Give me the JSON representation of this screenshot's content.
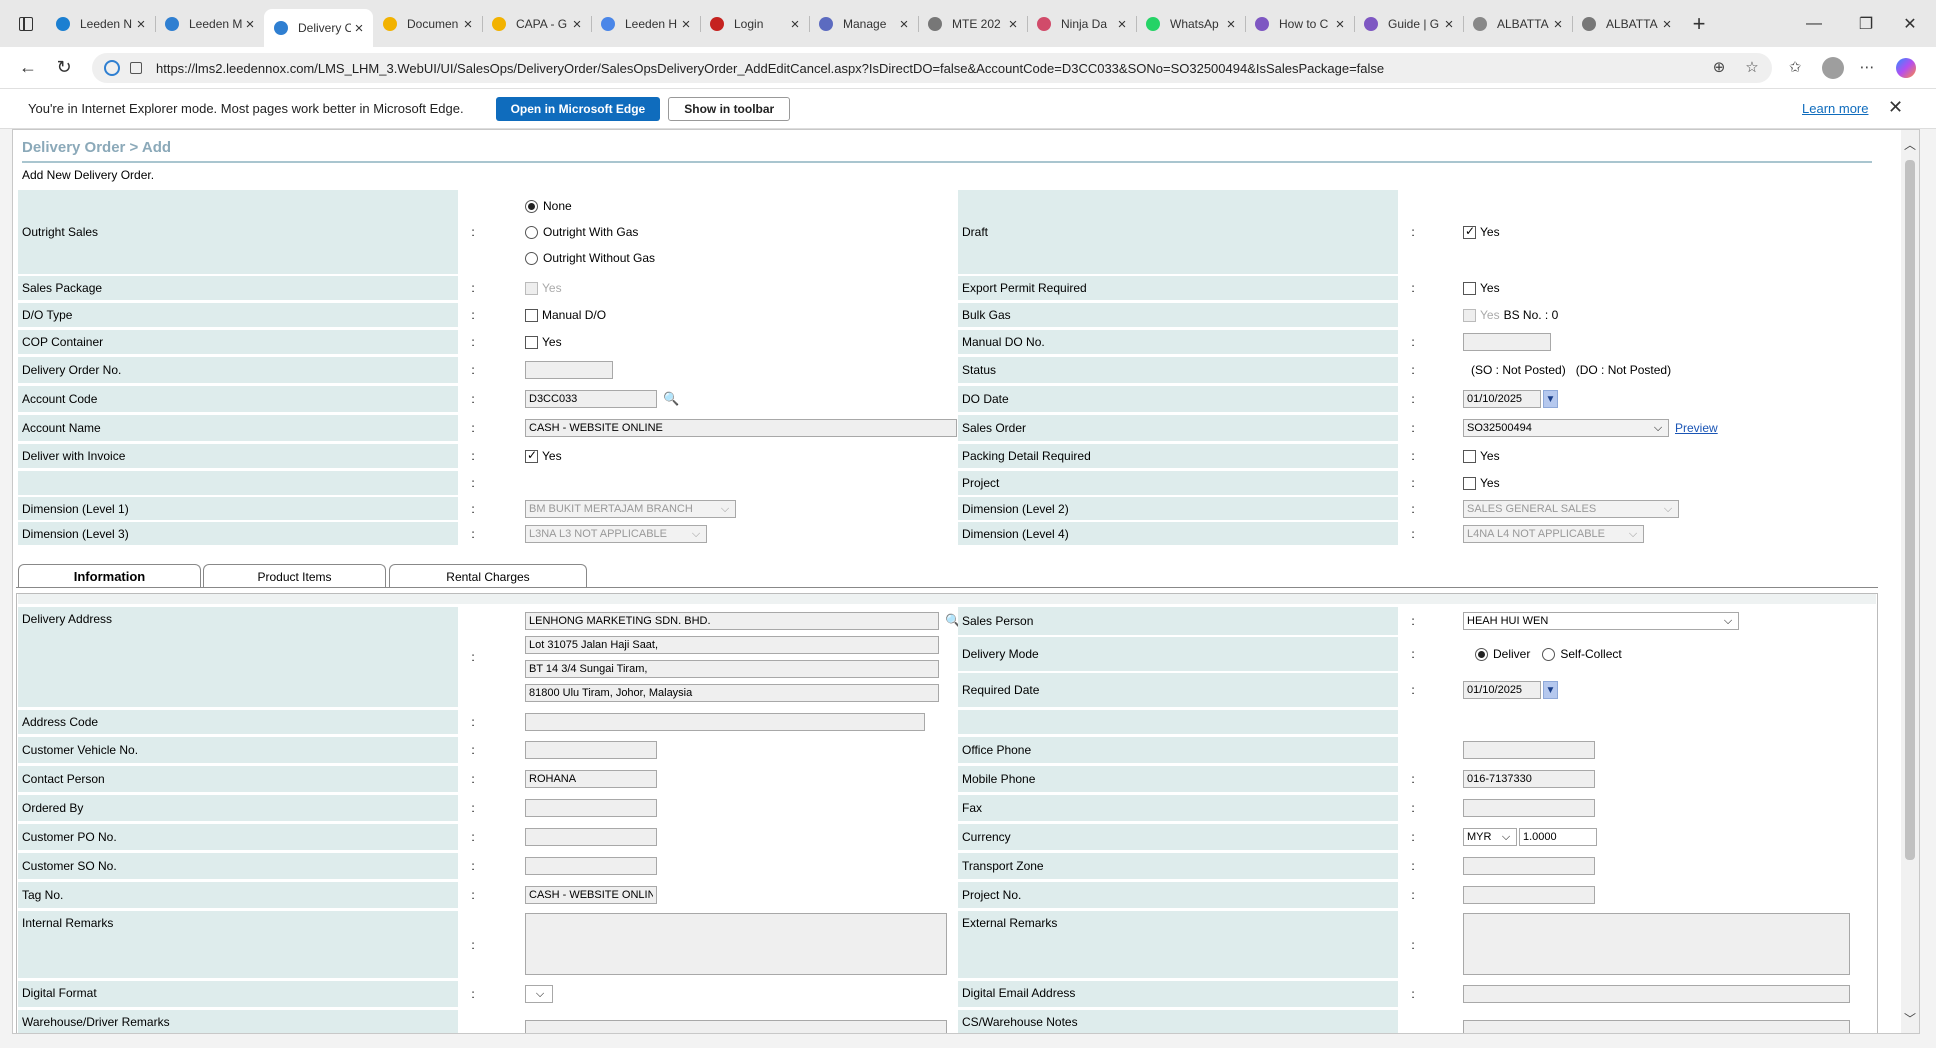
{
  "browser": {
    "tabs": [
      {
        "label": "Leeden N",
        "color": "#1b7fd1"
      },
      {
        "label": "Leeden M",
        "color": "#2f7fd1"
      },
      {
        "label": "Delivery O",
        "color": "#2f7fd1",
        "active": true
      },
      {
        "label": "Documen",
        "color": "#f2b200"
      },
      {
        "label": "CAPA - G",
        "color": "#f2b200"
      },
      {
        "label": "Leeden H",
        "color": "#4a86e8"
      },
      {
        "label": "Login",
        "color": "#c5221f"
      },
      {
        "label": "Manage",
        "color": "#5c6bc0"
      },
      {
        "label": "MTE 202",
        "color": "#777777"
      },
      {
        "label": "Ninja Da",
        "color": "#d14b6a"
      },
      {
        "label": "WhatsAp",
        "color": "#25d366"
      },
      {
        "label": "How to C",
        "color": "#7e57c2"
      },
      {
        "label": "Guide | G",
        "color": "#7e57c2"
      },
      {
        "label": "ALBATTA",
        "color": "#888888"
      },
      {
        "label": "ALBATTA",
        "color": "#777777"
      }
    ],
    "url": "https://lms2.leedennox.com/LMS_LHM_3.WebUI/UI/SalesOps/DeliveryOrder/SalesOpsDeliveryOrder_AddEditCancel.aspx?IsDirectDO=false&AccountCode=D3CC033&SONo=SO32500494&IsSalesPackage=false",
    "ie_message": "You're in Internet Explorer mode. Most pages work better in Microsoft Edge.",
    "open_edge_label": "Open in Microsoft Edge",
    "show_toolbar_label": "Show in toolbar",
    "learn_more_label": "Learn more"
  },
  "page": {
    "title": "Delivery Order > Add",
    "subtitle": "Add New Delivery Order."
  },
  "header_form": {
    "outright_sales": {
      "label": "Outright Sales",
      "options": [
        "None",
        "Outright With Gas",
        "Outright Without Gas"
      ],
      "selected": "None"
    },
    "draft": {
      "label": "Draft",
      "checkbox_label": "Yes",
      "checked": true
    },
    "sales_package": {
      "label": "Sales Package",
      "checkbox_label": "Yes"
    },
    "export_permit": {
      "label": "Export Permit Required",
      "checkbox_label": "Yes"
    },
    "do_type": {
      "label": "D/O Type",
      "checkbox_label": "Manual D/O"
    },
    "bulk_gas": {
      "label": "Bulk Gas",
      "checkbox_label": "Yes",
      "bs_no": "BS No. : 0"
    },
    "cop_container": {
      "label": "COP Container",
      "checkbox_label": "Yes"
    },
    "manual_do_no": {
      "label": "Manual DO No.",
      "value": ""
    },
    "delivery_order_no": {
      "label": "Delivery Order No.",
      "value": ""
    },
    "status": {
      "label": "Status",
      "value": "(SO : Not Posted)   (DO : Not Posted)"
    },
    "account_code": {
      "label": "Account Code",
      "value": "D3CC033"
    },
    "do_date": {
      "label": "DO Date",
      "value": "01/10/2025"
    },
    "account_name": {
      "label": "Account Name",
      "value": "CASH - WEBSITE ONLINE"
    },
    "sales_order": {
      "label": "Sales Order",
      "value": "SO32500494",
      "preview_label": "Preview"
    },
    "deliver_with_invoice": {
      "label": "Deliver with Invoice",
      "checkbox_label": "Yes",
      "checked": true
    },
    "packing_detail": {
      "label": "Packing Detail Required",
      "checkbox_label": "Yes"
    },
    "project": {
      "label": "Project",
      "checkbox_label": "Yes"
    },
    "dimension1": {
      "label": "Dimension (Level 1)",
      "value": "BM BUKIT MERTAJAM BRANCH"
    },
    "dimension2": {
      "label": "Dimension (Level 2)",
      "value": "SALES GENERAL SALES"
    },
    "dimension3": {
      "label": "Dimension (Level 3)",
      "value": "L3NA L3 NOT APPLICABLE"
    },
    "dimension4": {
      "label": "Dimension (Level 4)",
      "value": "L4NA L4 NOT APPLICABLE"
    },
    "colon": ":"
  },
  "tabs": [
    "Information",
    "Product Items",
    "Rental Charges"
  ],
  "info": {
    "delivery_address": {
      "label": "Delivery Address",
      "lines": [
        "LENHONG MARKETING SDN. BHD.",
        "Lot 31075 Jalan Haji Saat,",
        "BT 14 3/4 Sungai Tiram,",
        "81800 Ulu Tiram, Johor, Malaysia"
      ]
    },
    "sales_person": {
      "label": "Sales Person",
      "value": "HEAH HUI WEN"
    },
    "delivery_mode": {
      "label": "Delivery Mode",
      "options": [
        "Deliver",
        "Self-Collect"
      ],
      "selected": "Deliver"
    },
    "required_date": {
      "label": "Required Date",
      "value": "01/10/2025"
    },
    "address_code": {
      "label": "Address Code",
      "value": ""
    },
    "customer_vehicle_no": {
      "label": "Customer Vehicle No.",
      "value": ""
    },
    "office_phone": {
      "label": "Office Phone",
      "value": ""
    },
    "contact_person": {
      "label": "Contact Person",
      "value": "ROHANA"
    },
    "mobile_phone": {
      "label": "Mobile Phone",
      "value": "016-7137330"
    },
    "ordered_by": {
      "label": "Ordered By",
      "value": ""
    },
    "fax": {
      "label": "Fax",
      "value": ""
    },
    "customer_po_no": {
      "label": "Customer PO No.",
      "value": ""
    },
    "currency": {
      "label": "Currency",
      "value": "MYR",
      "rate": "1.0000"
    },
    "customer_so_no": {
      "label": "Customer SO No.",
      "value": ""
    },
    "transport_zone": {
      "label": "Transport Zone",
      "value": ""
    },
    "tag_no": {
      "label": "Tag No.",
      "value": "CASH - WEBSITE ONLIN"
    },
    "project_no": {
      "label": "Project No.",
      "value": ""
    },
    "internal_remarks": {
      "label": "Internal Remarks"
    },
    "external_remarks": {
      "label": "External Remarks"
    },
    "digital_format": {
      "label": "Digital Format"
    },
    "digital_email": {
      "label": "Digital Email Address"
    },
    "warehouse_remarks": {
      "label": "Warehouse/Driver Remarks"
    },
    "cs_warehouse_notes": {
      "label": "CS/Warehouse Notes"
    }
  }
}
